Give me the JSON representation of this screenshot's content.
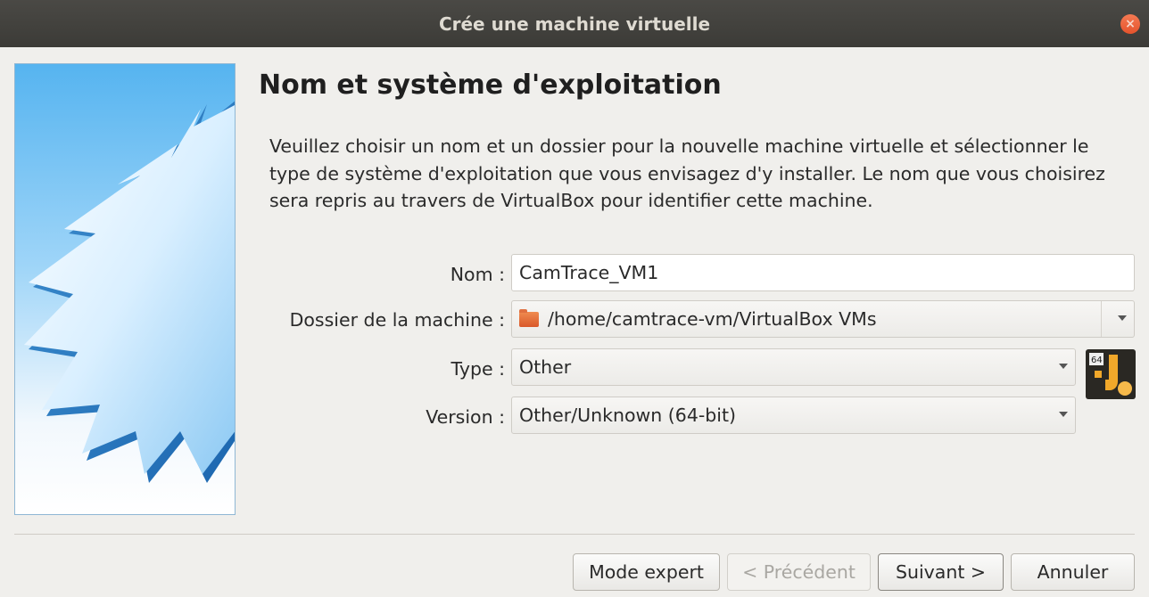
{
  "window": {
    "title": "Crée une machine virtuelle",
    "close_glyph": "×"
  },
  "page": {
    "heading": "Nom et système d'exploitation",
    "description": "Veuillez choisir un nom et un dossier pour la nouvelle machine virtuelle et sélectionner le type de système d'exploitation que vous envisagez d'y installer. Le nom que vous choisirez sera repris au travers de VirtualBox pour identifier cette machine."
  },
  "form": {
    "name": {
      "label": "Nom :",
      "value": "CamTrace_VM1"
    },
    "folder": {
      "label": "Dossier de la machine :",
      "value": "/home/camtrace-vm/VirtualBox VMs",
      "icon": "folder-icon"
    },
    "type": {
      "label": "Type :",
      "value": "Other"
    },
    "version": {
      "label": "Version :",
      "value": "Other/Unknown (64-bit)"
    },
    "os_icon": {
      "badge": "64",
      "icon": "os-other-64-icon"
    }
  },
  "buttons": {
    "expert": "Mode expert",
    "previous": "< Précédent",
    "next": "Suivant >",
    "cancel": "Annuler"
  },
  "colors": {
    "titlebar": "#3c3b37",
    "close": "#e95420",
    "watermark_top": "#56b4f0",
    "folder": "#e06a35"
  }
}
